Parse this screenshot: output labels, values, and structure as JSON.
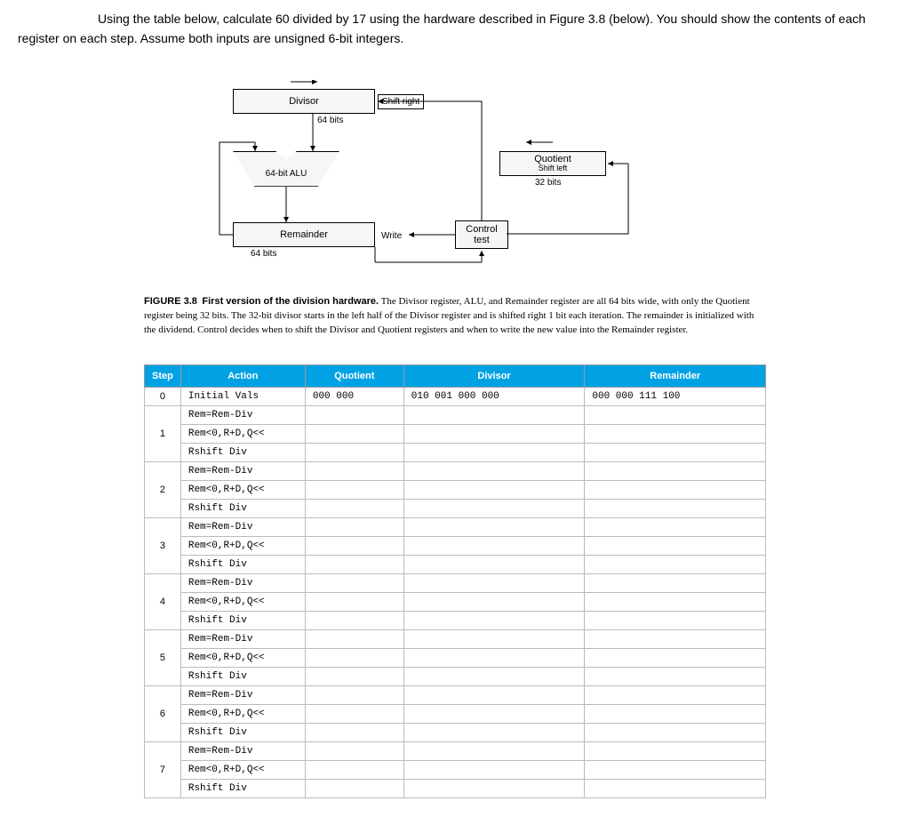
{
  "question": {
    "line1_a": "Using the table below, calculate 60 divided by 17 using the hardware described in Figure 3.8 (below). You should show the contents of each",
    "line2": "register on each step. Assume both inputs are unsigned 6-bit integers."
  },
  "figure": {
    "divisor": "Divisor",
    "divisor_bits": "64 bits",
    "shift_right": "Shift right",
    "alu": "64-bit ALU",
    "quotient": "Quotient",
    "quotient_shift": "Shift left",
    "quotient_bits": "32 bits",
    "remainder": "Remainder",
    "remainder_bits": "64 bits",
    "write": "Write",
    "control": "Control\ntest"
  },
  "caption": {
    "lead": "FIGURE 3.8",
    "bold": "First version of the division hardware.",
    "body": "The Divisor register, ALU, and Remainder register are all 64 bits wide, with only the Quotient register being 32 bits. The 32-bit divisor starts in the left half of the Divisor register and is shifted right 1 bit each iteration. The remainder is initialized with the dividend. Control decides when to shift the Divisor and Quotient registers and when to write the new value into the Remainder register."
  },
  "table": {
    "headers": {
      "step": "Step",
      "action": "Action",
      "quotient": "Quotient",
      "divisor": "Divisor",
      "remainder": "Remainder"
    },
    "actions": {
      "init": "Initial Vals",
      "sub": "Rem=Rem-Div",
      "test": "Rem<0,R+D,Q<<",
      "shift": "Rshift Div"
    },
    "init_row": {
      "quotient": "000 000",
      "divisor": "010 001 000 000",
      "remainder": "000 000 111 100"
    },
    "steps": [
      1,
      2,
      3,
      4,
      5,
      6,
      7
    ]
  }
}
